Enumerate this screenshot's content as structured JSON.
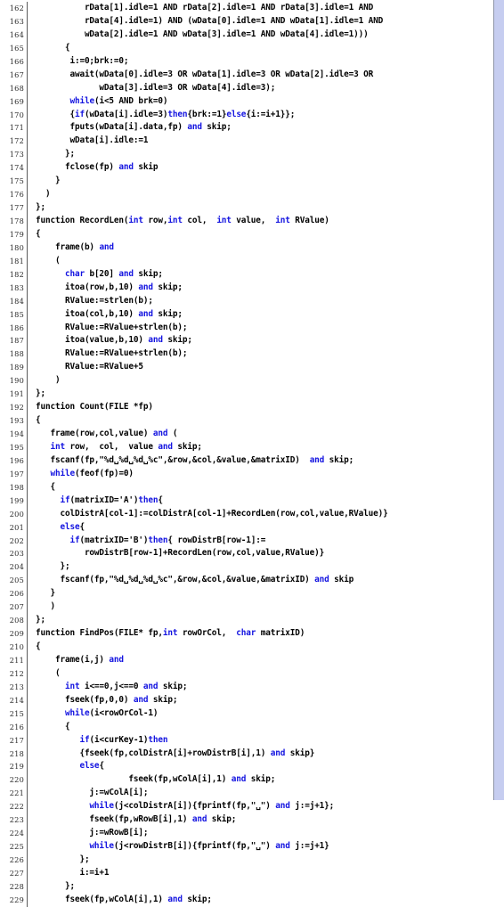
{
  "document": {
    "kind": "source-code-listing",
    "language_style": "pseudo-C / Seuss-style concurrent pseudocode",
    "first_line_number": 162,
    "last_line_number": 229,
    "colors": {
      "background": "#ffffff",
      "code_text": "#000000",
      "keyword": "#1414e0",
      "line_number": "#2c2c2c",
      "gutter_rule": "#5a5a5a",
      "page_edge": "#c6cdf0",
      "page_edge_border": "#8d93a8"
    }
  },
  "keywords": [
    "int",
    "char",
    "while",
    "if",
    "then",
    "else",
    "and",
    "function",
    "frame",
    "await",
    "skip",
    "AND",
    "OR"
  ],
  "lines": [
    {
      "n": "162",
      "segments": [
        {
          "t": "          rData[1].idle=1 AND rData[2].idle=1 AND rData[3].idle=1 AND"
        }
      ]
    },
    {
      "n": "163",
      "segments": [
        {
          "t": "          rData[4].idle=1) AND (wData[0].idle=1 AND wData[1].idle=1 AND"
        }
      ]
    },
    {
      "n": "164",
      "segments": [
        {
          "t": "          wData[2].idle=1 AND wData[3].idle=1 AND wData[4].idle=1)))"
        }
      ]
    },
    {
      "n": "165",
      "segments": [
        {
          "t": "      {"
        }
      ]
    },
    {
      "n": "166",
      "segments": [
        {
          "t": "       i:=0;brk:=0;"
        }
      ]
    },
    {
      "n": "167",
      "segments": [
        {
          "t": "       await(wData[0].idle=3 OR wData[1].idle=3 OR wData[2].idle=3 OR"
        }
      ]
    },
    {
      "n": "168",
      "segments": [
        {
          "t": "             wData[3].idle=3 OR wData[4].idle=3);"
        }
      ]
    },
    {
      "n": "169",
      "segments": [
        {
          "t": "       "
        },
        {
          "t": "while",
          "c": "kw"
        },
        {
          "t": "(i<5 AND brk=0)"
        }
      ]
    },
    {
      "n": "170",
      "segments": [
        {
          "t": "       {"
        },
        {
          "t": "if",
          "c": "kw"
        },
        {
          "t": "(wData[i].idle=3)"
        },
        {
          "t": "then",
          "c": "kw"
        },
        {
          "t": "{brk:=1}"
        },
        {
          "t": "else",
          "c": "kw"
        },
        {
          "t": "{i:=i+1}};"
        }
      ]
    },
    {
      "n": "171",
      "segments": [
        {
          "t": "       fputs(wData[i].data,fp) "
        },
        {
          "t": "and",
          "c": "kw"
        },
        {
          "t": " skip;"
        }
      ]
    },
    {
      "n": "172",
      "segments": [
        {
          "t": "       wData[i].idle:=1"
        }
      ]
    },
    {
      "n": "173",
      "segments": [
        {
          "t": "      };"
        }
      ]
    },
    {
      "n": "174",
      "segments": [
        {
          "t": "      fclose(fp) "
        },
        {
          "t": "and",
          "c": "kw"
        },
        {
          "t": " skip"
        }
      ]
    },
    {
      "n": "175",
      "segments": [
        {
          "t": "    }"
        }
      ]
    },
    {
      "n": "176",
      "segments": [
        {
          "t": "  )"
        }
      ]
    },
    {
      "n": "177",
      "segments": [
        {
          "t": "};"
        }
      ]
    },
    {
      "n": "178",
      "segments": [
        {
          "t": "function RecordLen("
        },
        {
          "t": "int",
          "c": "kw"
        },
        {
          "t": " row,"
        },
        {
          "t": "int",
          "c": "kw"
        },
        {
          "t": " col,  "
        },
        {
          "t": "int",
          "c": "kw"
        },
        {
          "t": " value,  "
        },
        {
          "t": "int",
          "c": "kw"
        },
        {
          "t": " RValue)"
        }
      ]
    },
    {
      "n": "179",
      "segments": [
        {
          "t": "{"
        }
      ]
    },
    {
      "n": "180",
      "segments": [
        {
          "t": "    frame(b) "
        },
        {
          "t": "and",
          "c": "kw"
        }
      ]
    },
    {
      "n": "181",
      "segments": [
        {
          "t": "    ("
        }
      ]
    },
    {
      "n": "182",
      "segments": [
        {
          "t": "      "
        },
        {
          "t": "char",
          "c": "kw"
        },
        {
          "t": " b[20] "
        },
        {
          "t": "and",
          "c": "kw"
        },
        {
          "t": " skip;"
        }
      ]
    },
    {
      "n": "183",
      "segments": [
        {
          "t": "      itoa(row,b,10) "
        },
        {
          "t": "and",
          "c": "kw"
        },
        {
          "t": " skip;"
        }
      ]
    },
    {
      "n": "184",
      "segments": [
        {
          "t": "      RValue:=strlen(b);"
        }
      ]
    },
    {
      "n": "185",
      "segments": [
        {
          "t": "      itoa(col,b,10) "
        },
        {
          "t": "and",
          "c": "kw"
        },
        {
          "t": " skip;"
        }
      ]
    },
    {
      "n": "186",
      "segments": [
        {
          "t": "      RValue:=RValue+strlen(b);"
        }
      ]
    },
    {
      "n": "187",
      "segments": [
        {
          "t": "      itoa(value,b,10) "
        },
        {
          "t": "and",
          "c": "kw"
        },
        {
          "t": " skip;"
        }
      ]
    },
    {
      "n": "188",
      "segments": [
        {
          "t": "      RValue:=RValue+strlen(b);"
        }
      ]
    },
    {
      "n": "189",
      "segments": [
        {
          "t": "      RValue:=RValue+5"
        }
      ]
    },
    {
      "n": "190",
      "segments": [
        {
          "t": "    )"
        }
      ]
    },
    {
      "n": "191",
      "segments": [
        {
          "t": "};"
        }
      ]
    },
    {
      "n": "192",
      "segments": [
        {
          "t": "function Count(FILE *fp)"
        }
      ]
    },
    {
      "n": "193",
      "segments": [
        {
          "t": "{"
        }
      ]
    },
    {
      "n": "194",
      "segments": [
        {
          "t": "   frame(row,col,value) "
        },
        {
          "t": "and",
          "c": "kw"
        },
        {
          "t": " ("
        }
      ]
    },
    {
      "n": "195",
      "segments": [
        {
          "t": "   "
        },
        {
          "t": "int",
          "c": "kw"
        },
        {
          "t": " row,  col,  value "
        },
        {
          "t": "and",
          "c": "kw"
        },
        {
          "t": " skip;"
        }
      ]
    },
    {
      "n": "196",
      "segments": [
        {
          "t": "   fscanf(fp,\"%d␣%d␣%d␣%c\",&row,&col,&value,&matrixID)  "
        },
        {
          "t": "and",
          "c": "kw"
        },
        {
          "t": " skip;"
        }
      ]
    },
    {
      "n": "197",
      "segments": [
        {
          "t": "   "
        },
        {
          "t": "while",
          "c": "kw"
        },
        {
          "t": "(feof(fp)=0)"
        }
      ]
    },
    {
      "n": "198",
      "segments": [
        {
          "t": "   {"
        }
      ]
    },
    {
      "n": "199",
      "segments": [
        {
          "t": "     "
        },
        {
          "t": "if",
          "c": "kw"
        },
        {
          "t": "(matrixID='A')"
        },
        {
          "t": "then",
          "c": "kw"
        },
        {
          "t": "{"
        }
      ]
    },
    {
      "n": "200",
      "segments": [
        {
          "t": "     colDistrA[col-1]:=colDistrA[col-1]+RecordLen(row,col,value,RValue)}"
        }
      ]
    },
    {
      "n": "201",
      "segments": [
        {
          "t": "     "
        },
        {
          "t": "else",
          "c": "kw"
        },
        {
          "t": "{"
        }
      ]
    },
    {
      "n": "202",
      "segments": [
        {
          "t": "       "
        },
        {
          "t": "if",
          "c": "kw"
        },
        {
          "t": "(matrixID='B')"
        },
        {
          "t": "then",
          "c": "kw"
        },
        {
          "t": "{ rowDistrB[row-1]:="
        }
      ]
    },
    {
      "n": "203",
      "segments": [
        {
          "t": "          rowDistrB[row-1]+RecordLen(row,col,value,RValue)}"
        }
      ]
    },
    {
      "n": "204",
      "segments": [
        {
          "t": "     };"
        }
      ]
    },
    {
      "n": "205",
      "segments": [
        {
          "t": "     fscanf(fp,\"%d␣%d␣%d␣%c\",&row,&col,&value,&matrixID) "
        },
        {
          "t": "and",
          "c": "kw"
        },
        {
          "t": " skip"
        }
      ]
    },
    {
      "n": "206",
      "segments": [
        {
          "t": "   }"
        }
      ]
    },
    {
      "n": "207",
      "segments": [
        {
          "t": "   )"
        }
      ]
    },
    {
      "n": "208",
      "segments": [
        {
          "t": "};"
        }
      ]
    },
    {
      "n": "209",
      "segments": [
        {
          "t": "function FindPos(FILE* fp,"
        },
        {
          "t": "int",
          "c": "kw"
        },
        {
          "t": " rowOrCol,  "
        },
        {
          "t": "char",
          "c": "kw"
        },
        {
          "t": " matrixID)"
        }
      ]
    },
    {
      "n": "210",
      "segments": [
        {
          "t": "{"
        }
      ]
    },
    {
      "n": "211",
      "segments": [
        {
          "t": "    frame(i,j) "
        },
        {
          "t": "and",
          "c": "kw"
        }
      ]
    },
    {
      "n": "212",
      "segments": [
        {
          "t": "    ("
        }
      ]
    },
    {
      "n": "213",
      "segments": [
        {
          "t": "      "
        },
        {
          "t": "int",
          "c": "kw"
        },
        {
          "t": " i<==0,j<==0 "
        },
        {
          "t": "and",
          "c": "kw"
        },
        {
          "t": " skip;"
        }
      ]
    },
    {
      "n": "214",
      "segments": [
        {
          "t": "      fseek(fp,0,0) "
        },
        {
          "t": "and",
          "c": "kw"
        },
        {
          "t": " skip;"
        }
      ]
    },
    {
      "n": "215",
      "segments": [
        {
          "t": "      "
        },
        {
          "t": "while",
          "c": "kw"
        },
        {
          "t": "(i<rowOrCol-1)"
        }
      ]
    },
    {
      "n": "216",
      "segments": [
        {
          "t": "      {"
        }
      ]
    },
    {
      "n": "217",
      "segments": [
        {
          "t": "         "
        },
        {
          "t": "if",
          "c": "kw"
        },
        {
          "t": "(i<curKey-1)"
        },
        {
          "t": "then",
          "c": "kw"
        }
      ]
    },
    {
      "n": "218",
      "segments": [
        {
          "t": "         {fseek(fp,colDistrA[i]+rowDistrB[i],1) "
        },
        {
          "t": "and",
          "c": "kw"
        },
        {
          "t": " skip}"
        }
      ]
    },
    {
      "n": "219",
      "segments": [
        {
          "t": "         "
        },
        {
          "t": "else",
          "c": "kw"
        },
        {
          "t": "{"
        }
      ]
    },
    {
      "n": "220",
      "segments": [
        {
          "t": "                   fseek(fp,wColA[i],1) "
        },
        {
          "t": "and",
          "c": "kw"
        },
        {
          "t": " skip;"
        }
      ]
    },
    {
      "n": "221",
      "segments": [
        {
          "t": "           j:=wColA[i];"
        }
      ]
    },
    {
      "n": "222",
      "segments": [
        {
          "t": "           "
        },
        {
          "t": "while",
          "c": "kw"
        },
        {
          "t": "(j<colDistrA[i]){fprintf(fp,\"␣\") "
        },
        {
          "t": "and",
          "c": "kw"
        },
        {
          "t": " j:=j+1};"
        }
      ]
    },
    {
      "n": "223",
      "segments": [
        {
          "t": "           fseek(fp,wRowB[i],1) "
        },
        {
          "t": "and",
          "c": "kw"
        },
        {
          "t": " skip;"
        }
      ]
    },
    {
      "n": "224",
      "segments": [
        {
          "t": "           j:=wRowB[i];"
        }
      ]
    },
    {
      "n": "225",
      "segments": [
        {
          "t": "           "
        },
        {
          "t": "while",
          "c": "kw"
        },
        {
          "t": "(j<rowDistrB[i]){fprintf(fp,\"␣\") "
        },
        {
          "t": "and",
          "c": "kw"
        },
        {
          "t": " j:=j+1}"
        }
      ]
    },
    {
      "n": "226",
      "segments": [
        {
          "t": "         };"
        }
      ]
    },
    {
      "n": "227",
      "segments": [
        {
          "t": "         i:=i+1"
        }
      ]
    },
    {
      "n": "228",
      "segments": [
        {
          "t": "      };"
        }
      ]
    },
    {
      "n": "229",
      "segments": [
        {
          "t": "      fseek(fp,wColA[i],1) "
        },
        {
          "t": "and",
          "c": "kw"
        },
        {
          "t": " skip;"
        }
      ]
    }
  ]
}
